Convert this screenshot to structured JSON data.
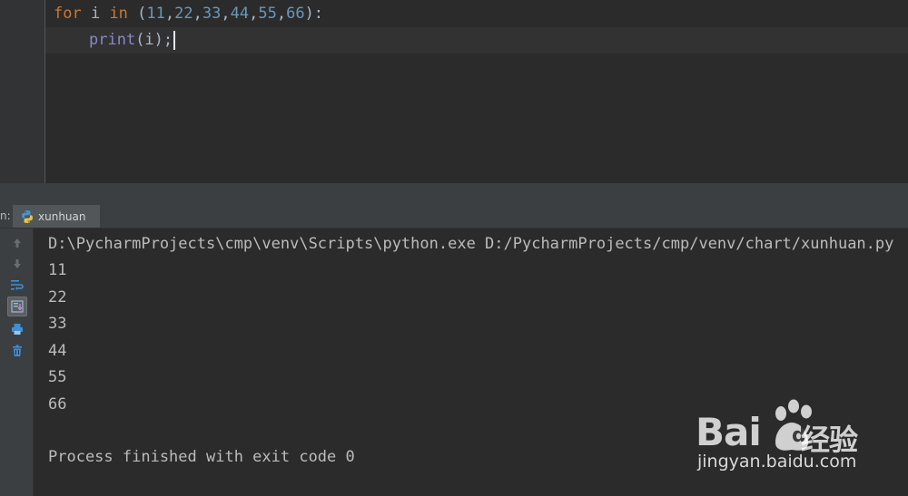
{
  "editor": {
    "line1": {
      "kw_for": "for",
      "var": " i ",
      "kw_in": "in",
      "open": " (",
      "nums": [
        "11",
        "22",
        "33",
        "44",
        "55",
        "66"
      ],
      "close": "):"
    },
    "line2": {
      "builtin": "print",
      "args": "(i);"
    }
  },
  "run_panel": {
    "tab_prefix": "n:",
    "tab_label": "xunhuan",
    "tab_icon": "python-icon",
    "toolbar_icons": [
      "up-arrow-icon",
      "down-arrow-icon",
      "soft-wrap-icon",
      "scroll-to-end-icon",
      "print-icon",
      "trash-icon"
    ],
    "console_lines": [
      "D:\\PycharmProjects\\cmp\\venv\\Scripts\\python.exe D:/PycharmProjects/cmp/venv/chart/xunhuan.py",
      "11",
      "22",
      "33",
      "44",
      "55",
      "66",
      "",
      "Process finished with exit code 0"
    ]
  },
  "watermark": {
    "logo_latin_1": "Bai",
    "logo_latin_2": "du",
    "logo_cn": "经验",
    "url": "jingyan.baidu.com"
  },
  "colors": {
    "editor_bg": "#2b2b2b",
    "keyword": "#cc7832",
    "number": "#6897bb",
    "builtin": "#8888c6",
    "text": "#a9b7c6",
    "console_text": "#bbbbbb",
    "panel_bg": "#3c3f41"
  }
}
